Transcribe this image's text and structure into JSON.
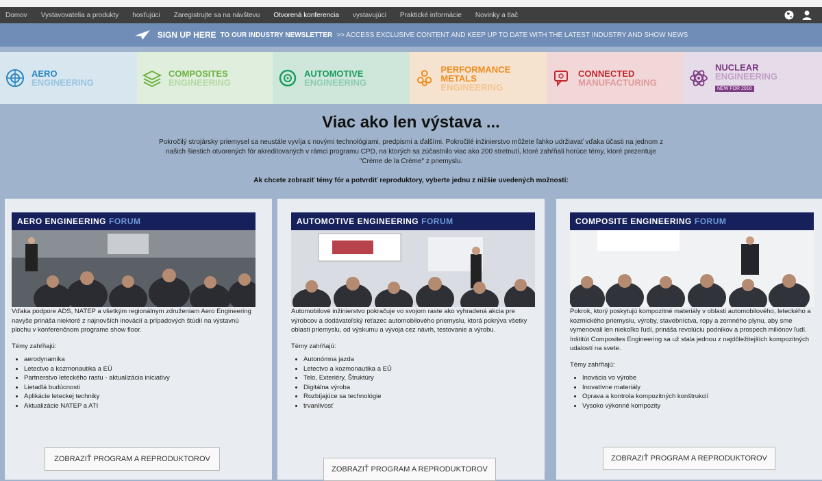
{
  "nav": {
    "items": [
      "Domov",
      "Vystavovatelia a produkty",
      "hosťujúci",
      "Zaregistrujte sa na návštevu",
      "Otvorená konferencia",
      "vystavujúci",
      "Praktické informácie",
      "Novinky a tlač"
    ],
    "active_index": 4
  },
  "promo": {
    "strong": "SIGN UP HERE",
    "mid": "TO OUR INDUSTRY NEWSLETTER",
    "rest": ">> ACCESS EXCLUSIVE CONTENT AND KEEP UP TO DATE WITH THE LATEST INDUSTRY AND SHOW NEWS"
  },
  "banner": [
    {
      "title": "AERO",
      "sub": "ENGINEERING",
      "color": "#2a86c4",
      "bg": "#d7e6ef"
    },
    {
      "title": "COMPOSITES",
      "sub": "ENGINEERING",
      "color": "#6db33f",
      "bg": "#dfeedd"
    },
    {
      "title": "AUTOMOTIVE",
      "sub": "ENGINEERING",
      "color": "#179b5e",
      "bg": "#cfe7db"
    },
    {
      "title": "PERFORMANCE METALS",
      "sub": "ENGINEERING",
      "color": "#f08c1e",
      "bg": "#f6e3cf"
    },
    {
      "title": "CONNECTED",
      "sub": "MANUFACTURING",
      "color": "#c1272d",
      "bg": "#f2d7d8"
    },
    {
      "title": "NUCLEAR",
      "sub": "ENGINEERING",
      "color": "#7b3a82",
      "bg": "#e6dbe8",
      "badge": "NEW FOR 2018"
    }
  ],
  "hero": {
    "title": "Viac ako len výstava ...",
    "text": "Pokročilý strojársky priemysel sa neustále vyvíja s novými technológiami, predpismi a ďalšími. Pokročilé inžinierstvo môžete ľahko udržiavať vďaka účasti na jednom z našich šiestich otvorených fór akreditovaných v rámci programu CPD, na ktorých sa zúčastnilo viac ako 200 stretnutí, ktoré zahŕňali horúce témy, ktoré prezentuje \"Crème de la Crème\" z priemyslu.",
    "cta": "Ak chcete zobraziť témy fór a potvrdiť reproduktory, vyberte jednu z nižšie uvedených možností:"
  },
  "cards": [
    {
      "header": "AERO ENGINEERING",
      "header_suffix": "FORUM",
      "desc": "Vďaka podpore ADS, NATEP a všetkým regionálnym združeniam Aero Engineering navyše prináša niektoré z najnovších inovácií a prípadových štúdií na výstavnú plochu v konferenčnom programe show floor.",
      "topics_label": "Témy zahŕňajú:",
      "topics": [
        "aerodynamika",
        "Letectvo a kozmonautika a EÚ",
        "Partnerstvo leteckého rastu - aktualizácia iniciatívy",
        "Lietadlá budúcnosti",
        "Aplikácie leteckej techniky",
        "Aktualizácie NATEP a ATI"
      ],
      "button": "ZOBRAZIŤ PROGRAM A REPRODUKTOROV"
    },
    {
      "header": "AUTOMOTIVE ENGINEERING",
      "header_suffix": "FORUM",
      "desc": "Automobilové inžinierstvo pokračuje vo svojom raste ako vyhradená akcia pre výrobcov a dodávateľský reťazec automobilového priemyslu, ktorá pokrýva všetky oblasti priemyslu, od výskumu a vývoja cez návrh, testovanie a výrobu.",
      "topics_label": "Témy zahŕňajú:",
      "topics": [
        "Autonómna jazda",
        "Letectvo a kozmonautika a EÚ",
        "Telo, Exteriéry, Štruktúry",
        "Digitálna výroba",
        "Rozbíjajúce sa technológie",
        "trvanlivosť"
      ],
      "button": "ZOBRAZIŤ PROGRAM A REPRODUKTOROV"
    },
    {
      "header": "COMPOSITE ENGINEERING",
      "header_suffix": "FORUM",
      "desc": "Pokrok, ktorý poskytujú kompozitné materiály v oblasti automobilového, leteckého a kozmického priemyslu, výroby, stavebníctva, ropy a zemného plynu, aby sme vymenovali len niekoľko ľudí, prináša revolúciu podnikov a prospech miliónov ľudí. Inštitút Composites Engineering sa už stala jednou z najdôležitejších kompozitných udalostí na svete.",
      "topics_label": "Témy zahŕňajú:",
      "topics": [
        "Inovácia vo výrobe",
        "Inovatívne materiály",
        "Oprava a kontrola kompozitných konštrukcií",
        "Vysoko výkonné kompozity"
      ],
      "button": "ZOBRAZIŤ PROGRAM A REPRODUKTOROV"
    }
  ]
}
